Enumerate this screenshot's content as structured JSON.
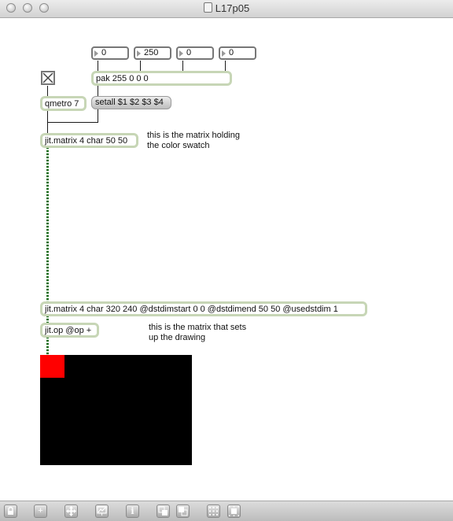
{
  "window": {
    "title": "L17p05"
  },
  "number_boxes": [
    {
      "value": "0"
    },
    {
      "value": "250"
    },
    {
      "value": "0"
    },
    {
      "value": "0"
    }
  ],
  "objects": {
    "pak": "pak 255 0 0 0",
    "qmetro": "qmetro 7",
    "setall": "setall $1 $2 $3 $4",
    "jit_matrix_small": "jit.matrix 4 char 50 50",
    "jit_matrix_big": "jit.matrix 4 char 320 240 @dstdimstart 0 0 @dstdimend 50 50 @usedstdim 1",
    "jit_op": "jit.op @op +"
  },
  "comments": {
    "swatch_line1": "this is the matrix holding",
    "swatch_line2": "the color swatch",
    "drawing_line1": "this is the matrix that sets",
    "drawing_line2": "up the drawing"
  },
  "toggle": {
    "checked": true
  },
  "colors": {
    "swatch": "#ff0000",
    "pwindow_bg": "#000000",
    "object_border": "#c7d6b6"
  },
  "toolbar": {
    "icons": [
      "lock-icon",
      "add-icon",
      "move-icon",
      "presentation-icon",
      "inspector-icon",
      "bring-front-icon",
      "send-back-icon",
      "grid-icon",
      "snap-icon"
    ],
    "glyphs": {
      "add": "+",
      "inspector": "i"
    }
  }
}
